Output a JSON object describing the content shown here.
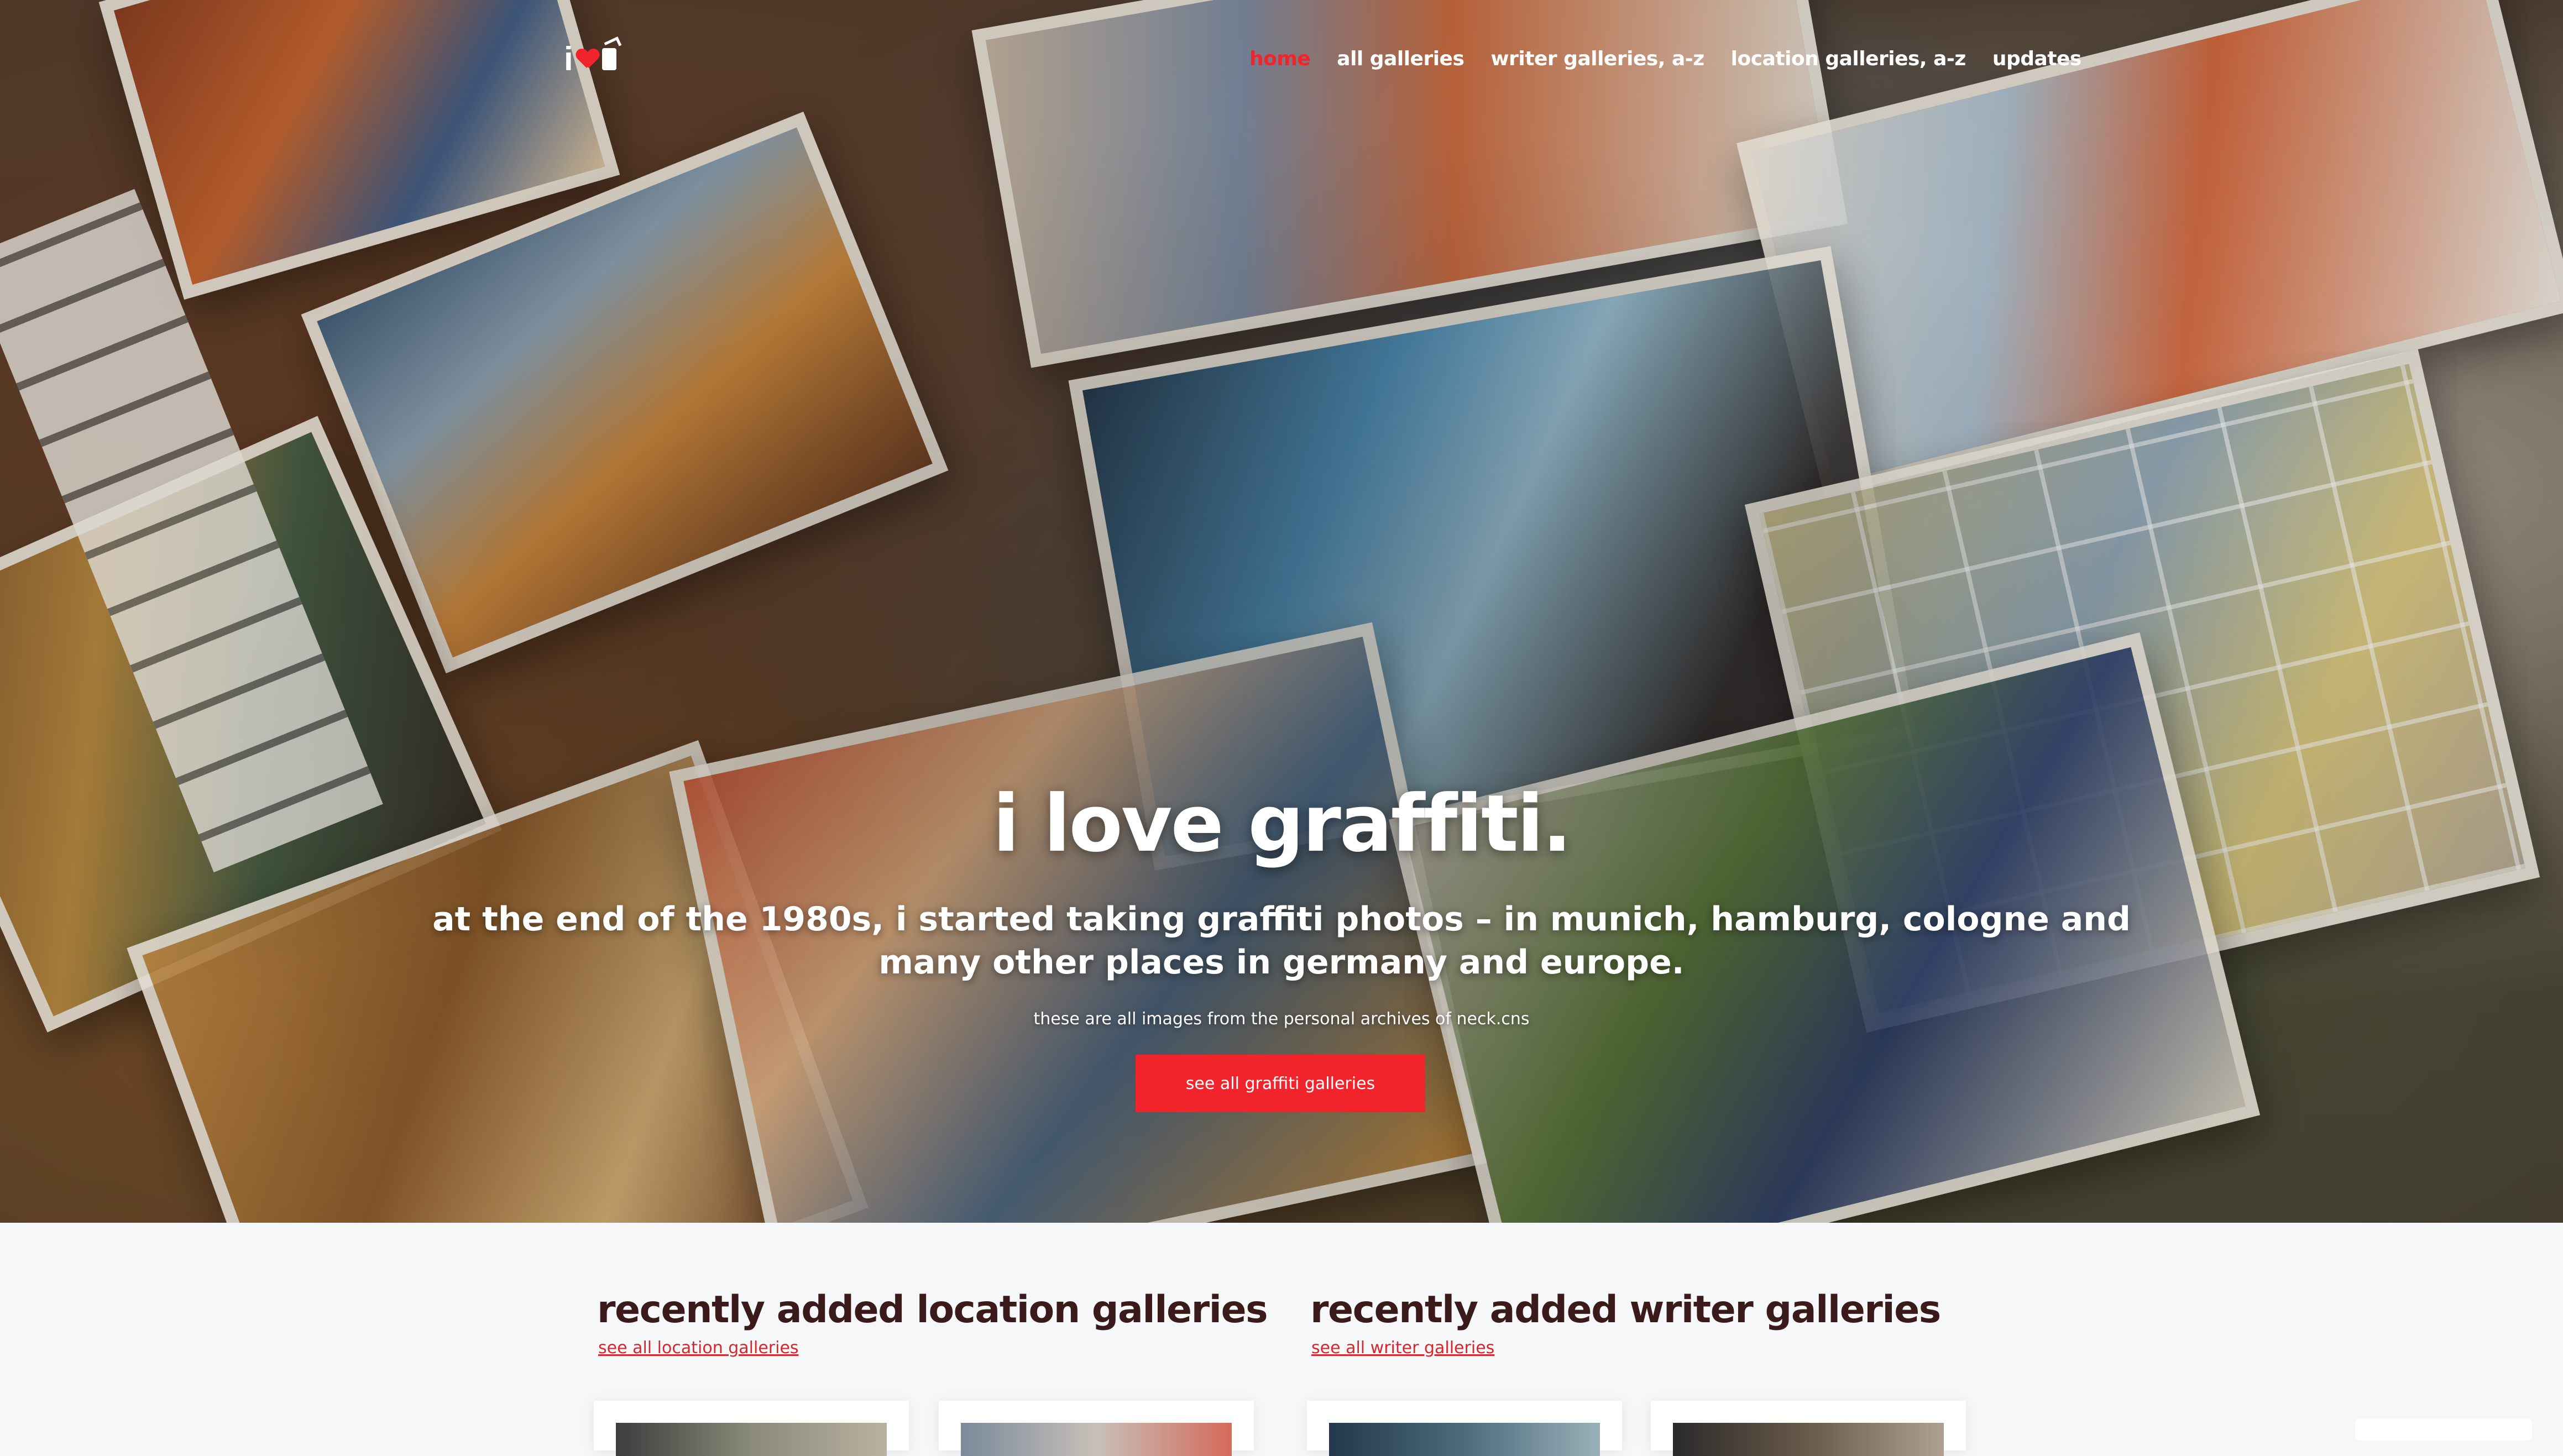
{
  "nav": {
    "items": [
      {
        "label": "home",
        "active": true
      },
      {
        "label": "all galleries",
        "active": false
      },
      {
        "label": "writer galleries, a-z",
        "active": false
      },
      {
        "label": "location galleries, a-z",
        "active": false
      },
      {
        "label": "updates",
        "active": false
      }
    ]
  },
  "hero": {
    "title": "i love graffiti.",
    "subtitle": "at the end of the 1980s, i started taking graffiti photos – in munich, hamburg, cologne and many other places in germany and europe.",
    "note": "these are all images from the personal archives of neck.cns",
    "cta_label": "see all graffiti galleries"
  },
  "sections": {
    "locations": {
      "heading": "recently added location galleries",
      "link": "see all location galleries"
    },
    "writers": {
      "heading": "recently added writer galleries",
      "link": "see all writer galleries"
    }
  },
  "colors": {
    "accent": "#f2242b",
    "heading": "#3a1a1a",
    "background": "#f6f7f9"
  },
  "icons": {
    "logo": "i-heart-spraycan-logo"
  }
}
